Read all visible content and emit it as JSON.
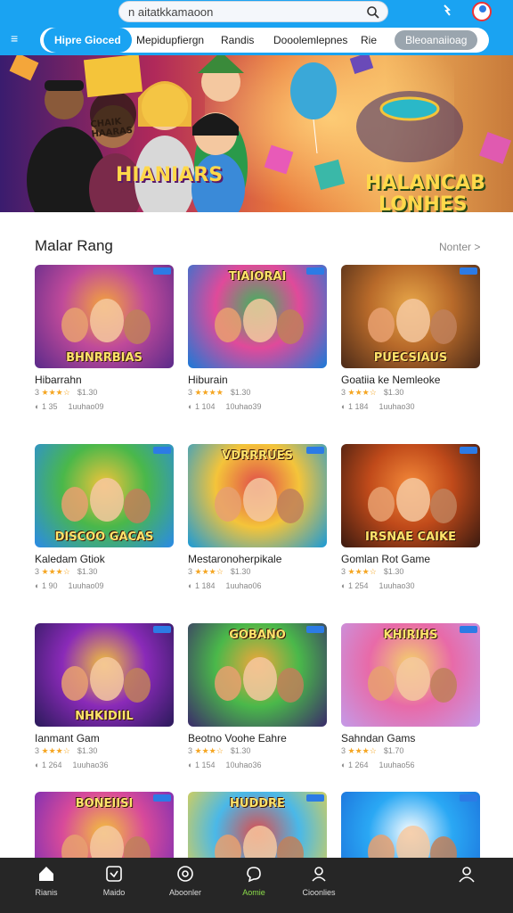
{
  "search": {
    "placeholder": "n aitatkkamaoon"
  },
  "nav": {
    "tabs": [
      {
        "label": "Hipre Gioced",
        "active": true
      },
      {
        "label": "Mepidupfiergn",
        "active": false
      },
      {
        "label": "Randis",
        "active": false
      },
      {
        "label": "Dooolemlepnes",
        "active": false
      },
      {
        "label": "Rie",
        "active": false
      }
    ],
    "cta_label": "Bleoanaiioag"
  },
  "banner": {
    "left_title": "HIANIARS",
    "sign_text": "CHAIK HAARAS",
    "logo_line1": "HALANCAB",
    "logo_line2": "LONHES"
  },
  "section": {
    "title": "Malar Rang",
    "more_label": "Nonter >"
  },
  "games": [
    {
      "name": "Hibarrahn",
      "rating": "3",
      "stars": "★★★☆",
      "size": "$1.30",
      "plays": "1 35",
      "downloads": "1uuhao09",
      "thumb_text": "BHNRRBIAS",
      "palette": [
        "#5a2a8a",
        "#c04a9a",
        "#f4a63a"
      ]
    },
    {
      "name": "Hiburain",
      "rating": "3",
      "stars": "★★★★",
      "size": "$1.30",
      "plays": "1 104",
      "downloads": "10uhao39",
      "thumb_text": "TIAIORAI",
      "palette": [
        "#1a7ad8",
        "#e04a9a",
        "#3ab85a"
      ]
    },
    {
      "name": "Goatiia ke Nemleoke",
      "rating": "3",
      "stars": "★★★☆",
      "size": "$1.30",
      "plays": "1 184",
      "downloads": "1uuhao30",
      "thumb_text": "PUECSIAUS",
      "palette": [
        "#4a2a18",
        "#b86a2a",
        "#e8a84a"
      ]
    },
    {
      "name": "Kaledam Gtiok",
      "rating": "3",
      "stars": "★★★☆",
      "size": "$1.30",
      "plays": "1 90",
      "downloads": "1uuhao09",
      "thumb_text": "DISCOO GACAS",
      "palette": [
        "#2a8ae8",
        "#4ab84a",
        "#f4c43a"
      ]
    },
    {
      "name": "Mestaronoherpikale",
      "rating": "3",
      "stars": "★★★☆",
      "size": "$1.30",
      "plays": "1 184",
      "downloads": "1uuhao06",
      "thumb_text": "VDRRRUES",
      "palette": [
        "#1a9ad8",
        "#f4c43a",
        "#e04a4a"
      ]
    },
    {
      "name": "Gomlan Rot Game",
      "rating": "3",
      "stars": "★★★☆",
      "size": "$1.30",
      "plays": "1 254",
      "downloads": "1uuhao30",
      "thumb_text": "IRSNAE CAIKE",
      "palette": [
        "#3a1a10",
        "#c04a1a",
        "#f48a3a"
      ]
    },
    {
      "name": "Ianmant Gam",
      "rating": "3",
      "stars": "★★★☆",
      "size": "$1.30",
      "plays": "1 264",
      "downloads": "1uuhao36",
      "thumb_text": "NHKIDIIL",
      "palette": [
        "#2a1a5a",
        "#8a2ab8",
        "#f4c43a"
      ]
    },
    {
      "name": "Beotno Voohe Eahre",
      "rating": "3",
      "stars": "★★★☆",
      "size": "$1.30",
      "plays": "1 154",
      "downloads": "10uhao36",
      "thumb_text": "GOBANO",
      "palette": [
        "#3a2a6a",
        "#4ab84a",
        "#f4a63a"
      ]
    },
    {
      "name": "Sahndan Gams",
      "rating": "3",
      "stars": "★★★☆",
      "size": "$1.70",
      "plays": "1 264",
      "downloads": "1uuhao56",
      "thumb_text": "KHIRIHS",
      "palette": [
        "#c49ae8",
        "#e86aa8",
        "#f4d46a"
      ]
    },
    {
      "name": "",
      "rating": "",
      "stars": "",
      "size": "",
      "plays": "",
      "downloads": "",
      "thumb_text": "BONEIISI",
      "palette": [
        "#6a2ab8",
        "#d84a9a",
        "#f4c43a"
      ]
    },
    {
      "name": "",
      "rating": "",
      "stars": "",
      "size": "",
      "plays": "",
      "downloads": "",
      "thumb_text": "HUDDRE",
      "palette": [
        "#f4d43a",
        "#4ab8e8",
        "#e04a4a"
      ]
    },
    {
      "name": "",
      "rating": "",
      "stars": "",
      "size": "",
      "plays": "",
      "downloads": "",
      "thumb_text": "",
      "palette": [
        "#1a6ad8",
        "#2aa8f4",
        "#ffffff"
      ]
    }
  ],
  "bottom_nav": [
    {
      "label": "Rianis",
      "icon": "home-icon",
      "active": false
    },
    {
      "label": "Maido",
      "icon": "gamepad-icon",
      "active": false
    },
    {
      "label": "Aboonler",
      "icon": "controller-icon",
      "active": false
    },
    {
      "label": "Aomie",
      "icon": "chat-icon",
      "active": true
    },
    {
      "label": "Cioonlies",
      "icon": "people-icon",
      "active": false
    },
    {
      "label": "",
      "icon": "profile-icon",
      "active": false
    }
  ],
  "colors": {
    "accent": "#1aa3f2",
    "star": "#f5a623",
    "bottom_bar": "#262626",
    "active_nav": "#8bdc4a"
  }
}
